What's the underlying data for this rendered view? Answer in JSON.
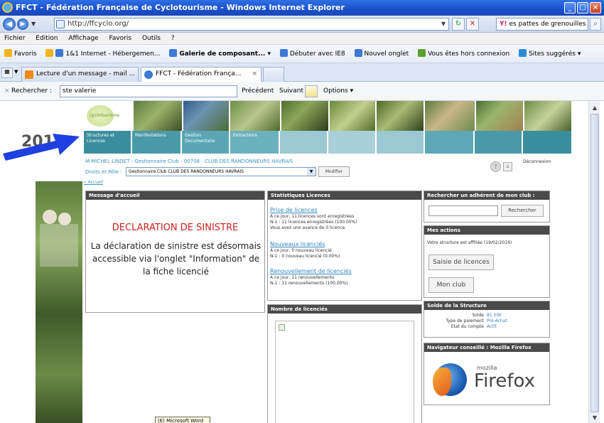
{
  "window": {
    "title": "FFCT - Fédération Française de Cyclotourisme - Windows Internet Explorer",
    "buttons": {
      "minimize": "_",
      "maximize": "□",
      "close": "×"
    }
  },
  "nav": {
    "address": "http://ffcyclo.org/",
    "search_text": "es pattes de grenouilles"
  },
  "menu": [
    "Fichier",
    "Edition",
    "Affichage",
    "Favoris",
    "Outils",
    "?"
  ],
  "favorites": {
    "label": "Favoris",
    "items": [
      "1&1 Internet - Hébergemen...",
      "Galerie de composant...",
      "Débuter avec IE8",
      "Nouvel onglet",
      "Vous êtes hors connexion",
      "Sites suggérés"
    ]
  },
  "tabs": [
    {
      "label": "Lecture d'un message - mail ..."
    },
    {
      "label": "FFCT - Fédération França..."
    }
  ],
  "findbar": {
    "close": "×",
    "label": "Rechercher :",
    "value": "ste valerie",
    "prev": "Précédent",
    "next": "Suivant",
    "options": "Options"
  },
  "site": {
    "logo_text": "cyclotourisme",
    "year": "2014",
    "nav_tiles": [
      "Structures et Licences",
      "Manifestations",
      "Gestion Documentaire",
      "Extractions"
    ],
    "user_line": "M MICHEL LINDET - Gestionnaire Club - 00708 - CLUB DES RANDONNEURS HAVRAIS",
    "role_label": "Droits et Rôle :",
    "role_value": "Gestionnaire Club CLUB DES RANDONNEURS HAVRAIS",
    "modifier": "Modifier",
    "deconnexion": "Déconnexion",
    "breadcrumb": "Accueil"
  },
  "welcome": {
    "header": "Message d'accueil",
    "title": "DECLARATION DE SINISTRE",
    "body": "La déclaration de sinistre est désormais accessible via l'onglet \"Information\" de la fiche licencié"
  },
  "stats": {
    "header": "Statistiques Licences",
    "blocks": [
      {
        "title": "Prise de licences",
        "lines": [
          "A ce jour, 11 licences sont enregistrées",
          "N-1 : 11 licences enregistrées (100.00%)",
          "Vous avez une avance de 0 licence."
        ]
      },
      {
        "title": "Nouveaux licenciés",
        "lines": [
          "A ce jour, 0 nouveau licencié",
          "N-1 : 0 nouveau licencié (0.00%)"
        ]
      },
      {
        "title": "Renouvellement de licenciés",
        "lines": [
          "A ce jour, 11 renouvellements",
          "N-1 : 11 renouvellements (100.00%)"
        ]
      }
    ],
    "count_header": "Nombre de licenciés"
  },
  "right": {
    "search_header": "Rechercher un adhérent de mon club :",
    "search_button": "Rechercher",
    "actions_header": "Mes actions",
    "affiliation": "Votre structure est affiliée (19/02/2014)",
    "saisie_button": "Saisie de licences",
    "club_button": "Mon club",
    "solde_header": "Solde de la Structure",
    "solde_label": "Solde",
    "solde_value": "81.50€",
    "paiement_label": "Type de paiement",
    "paiement_value": "Pré-Achat",
    "etat_label": "Etat du compte",
    "etat_value": "Actif",
    "browser_header": "Navigateur conseillé : Mozilla Firefox",
    "mozilla": "mozilla",
    "firefox": "Firefox"
  },
  "taskbar_tooltip": "(E) Microsoft Word",
  "colors": {
    "titlebar": "#1a4fc9",
    "tile_dark": "#3d8fa0",
    "tile_light": "#9fc7d4",
    "link": "#2f88c3",
    "sinistre_red": "#cc1f1f",
    "arrow": "#1f3fe0"
  }
}
